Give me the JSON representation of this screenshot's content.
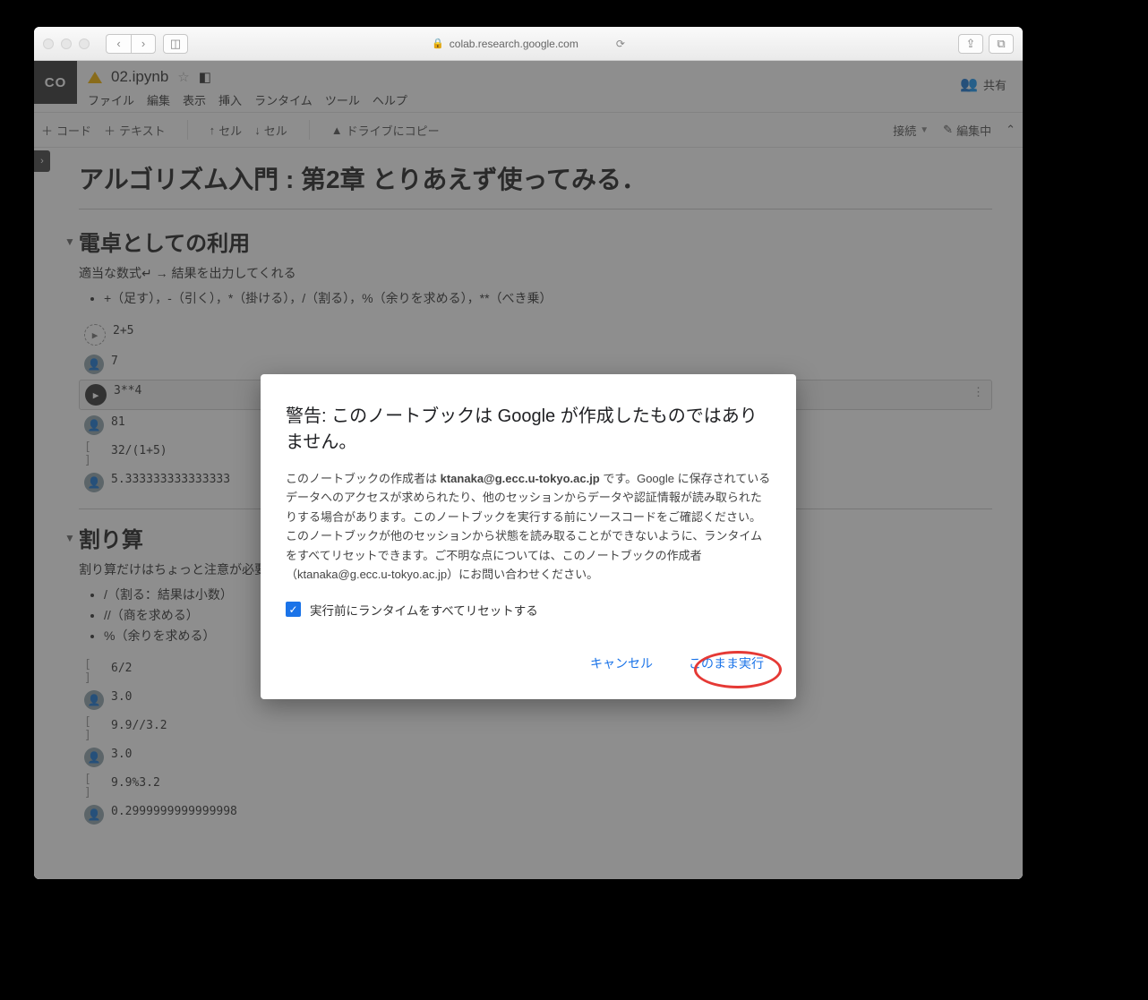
{
  "browser": {
    "url": "colab.research.google.com"
  },
  "colab": {
    "logo": "CO",
    "file_title": "02.ipynb",
    "menu": [
      "ファイル",
      "編集",
      "表示",
      "挿入",
      "ランタイム",
      "ツール",
      "ヘルプ"
    ],
    "share": "共有",
    "toolbar": {
      "code": "コード",
      "text": "テキスト",
      "cell_up": "セル",
      "cell_down": "セル",
      "copy_drive": "ドライブにコピー",
      "connect": "接続",
      "editing": "編集中"
    }
  },
  "content": {
    "title": "アルゴリズム入門 : 第2章 とりあえず使ってみる．",
    "sec1": {
      "heading": "電卓としての利用",
      "desc": "適当な数式↵ → 結果を出力してくれる",
      "ops": "+（足す），-（引く），*（掛ける），/（割る），%（余りを求める），**（べき乗）",
      "cells": [
        {
          "type": "in-dash",
          "code": "2+5"
        },
        {
          "type": "out",
          "val": "7"
        },
        {
          "type": "in-run",
          "code": "3**4",
          "current": true
        },
        {
          "type": "out",
          "val": "81"
        },
        {
          "type": "in-br",
          "code": "32/(1+5)"
        },
        {
          "type": "out",
          "val": "5.333333333333333"
        }
      ]
    },
    "sec2": {
      "heading": "割り算",
      "desc": "割り算だけはちょっと注意が必要",
      "ops": [
        "/（割る：結果は小数）",
        "//（商を求める）",
        "%（余りを求める）"
      ],
      "cells": [
        {
          "type": "in-br",
          "code": "6/2"
        },
        {
          "type": "out",
          "val": "3.0"
        },
        {
          "type": "in-br",
          "code": "9.9//3.2"
        },
        {
          "type": "out",
          "val": "3.0"
        },
        {
          "type": "in-br",
          "code": "9.9%3.2"
        },
        {
          "type": "out",
          "val": "0.2999999999999998"
        }
      ]
    }
  },
  "modal": {
    "title": "警告: このノートブックは Google が作成したものではありません。",
    "body_prefix": "このノートブックの作成者は ",
    "author": "ktanaka@g.ecc.u-tokyo.ac.jp",
    "body_suffix": " です。Google に保存されているデータへのアクセスが求められたり、他のセッションからデータや認証情報が読み取られたりする場合があります。このノートブックを実行する前にソースコードをご確認ください。このノートブックが他のセッションから状態を読み取ることができないように、ランタイムをすべてリセットできます。ご不明な点については、このノートブックの作成者（ktanaka@g.ecc.u-tokyo.ac.jp）にお問い合わせください。",
    "checkbox": "実行前にランタイムをすべてリセットする",
    "cancel": "キャンセル",
    "run_anyway": "このまま実行"
  }
}
